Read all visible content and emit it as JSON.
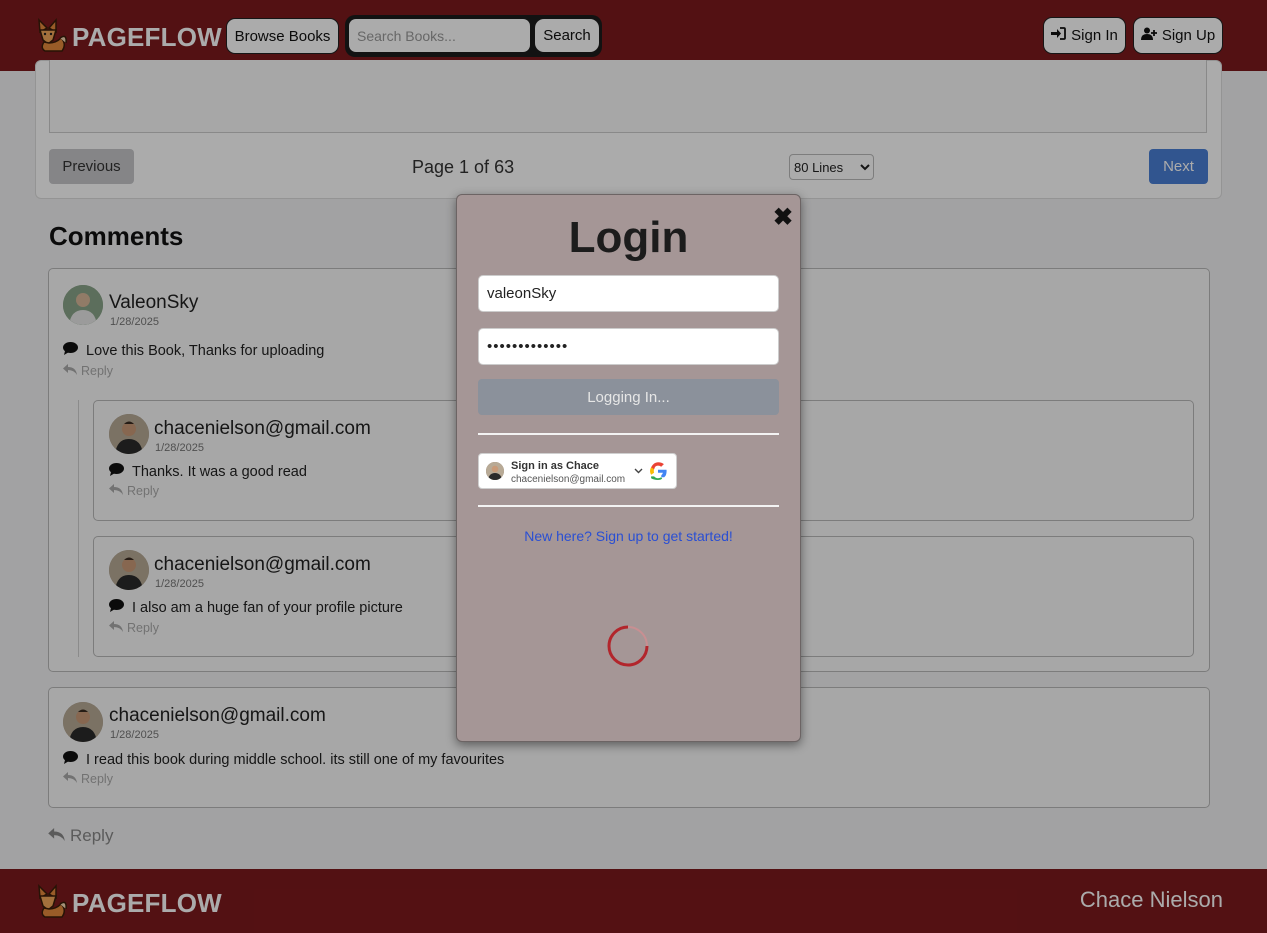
{
  "header": {
    "brand": "PAGEFLOW",
    "browse_label": "Browse Books",
    "search_placeholder": "Search Books...",
    "search_button": "Search",
    "sign_in": "Sign In",
    "sign_up": "Sign Up"
  },
  "reader": {
    "previous": "Previous",
    "page_info": "Page 1 of 63",
    "lines_option": "80 Lines",
    "next": "Next"
  },
  "comments": {
    "title": "Comments",
    "items": [
      {
        "name": "ValeonSky",
        "date": "1/28/2025",
        "text": "Love this Book, Thanks for uploading",
        "reply": "Reply"
      },
      {
        "name": "chacenielson@gmail.com",
        "date": "1/28/2025",
        "text": "Thanks. It was a good read",
        "reply": "Reply"
      },
      {
        "name": "chacenielson@gmail.com",
        "date": "1/28/2025",
        "text": "I also am a huge fan of your profile picture",
        "reply": "Reply"
      },
      {
        "name": "chacenielson@gmail.com",
        "date": "1/28/2025",
        "text": "I read this book during middle school. its still one of my favourites",
        "reply": "Reply"
      }
    ],
    "reply_main": "Reply"
  },
  "footer": {
    "brand": "PAGEFLOW",
    "name": "Chace Nielson"
  },
  "login_modal": {
    "title": "Login",
    "close": "✖",
    "username_value": "valeonSky",
    "password_masked": "•••••••••••••",
    "login_button": "Logging In...",
    "google_title": "Sign in as Chace",
    "google_email": "chacenielson@gmail.com",
    "signup_link": "New here? Sign up to get started!"
  },
  "colors": {
    "brand_red": "#7d1a1d",
    "next_blue": "#4a7fd6",
    "link_blue": "#2a4fd3",
    "spinner_red": "#b2262c"
  },
  "icons": [
    "fox-logo-icon",
    "sign-in-icon",
    "user-plus-icon",
    "comment-icon",
    "reply-icon",
    "close-icon",
    "chevron-down-icon",
    "google-icon",
    "loading-spinner-icon"
  ]
}
